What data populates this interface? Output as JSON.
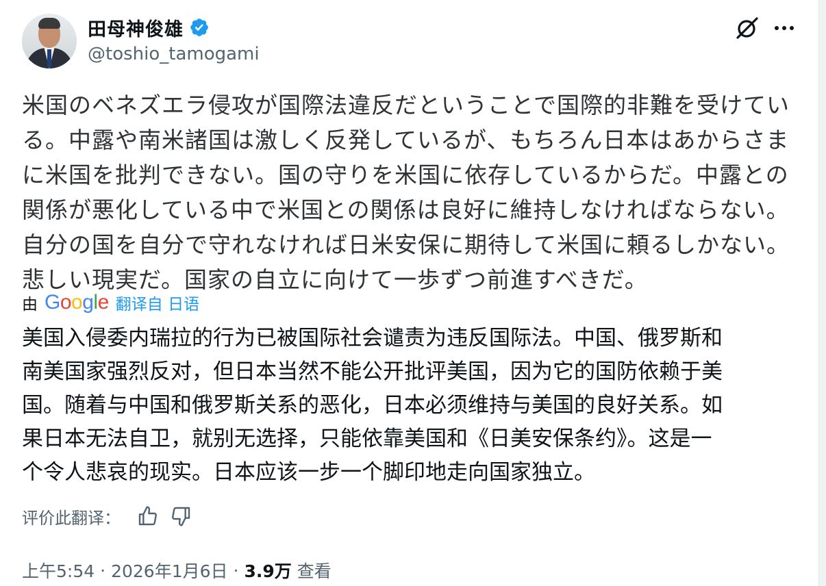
{
  "author": {
    "name": "田母神俊雄",
    "handle": "@toshio_tamogami",
    "verified": true
  },
  "icons": {
    "grok": "grok-icon",
    "more": "more-icon",
    "verified": "verified-badge-icon",
    "like_translation": "thumbs-up-icon",
    "dislike_translation": "thumbs-down-icon"
  },
  "tweet": {
    "original_text": "米国のベネズエラ侵攻が国際法違反だということで国際的非難を受けてい\nる。中露や南米諸国は激しく反発しているが、もちろん日本はあからさま\nに米国を批判できない。国の守りを米国に依存しているからだ。中露との\n関係が悪化している中で米国との関係は良好に維持しなければならない。\n自分の国を自分で守れなければ日米安保に期待して米国に頼るしかない。\n悲しい現実だ。国家の自立に向けて一歩ずつ前進すべきだ。",
    "translation_by": "由",
    "translation_provider": "Google",
    "translated_from": "翻译自 日语",
    "translated_text": "美国入侵委内瑞拉的行为已被国际社会谴责为违反国际法。中国、俄罗斯和\n南美国家强烈反对，但日本当然不能公开批评美国，因为它的国防依赖于美\n国。随着与中国和俄罗斯关系的恶化，日本必须维持与美国的良好关系。如\n果日本无法自卫，就别无选择，只能依靠美国和《日美安保条约》。这是一\n个令人悲哀的现实。日本应该一步一个脚印地走向国家独立。",
    "rate_translation_label": "评价此翻译："
  },
  "meta": {
    "time": "上午5:54",
    "date": "2026年1月6日",
    "separator": "·",
    "views_count": "3.9万",
    "views_label": "查看"
  },
  "colors": {
    "accent": "#1d9bf0",
    "text_primary": "#0f1419",
    "text_secondary": "#536471"
  }
}
